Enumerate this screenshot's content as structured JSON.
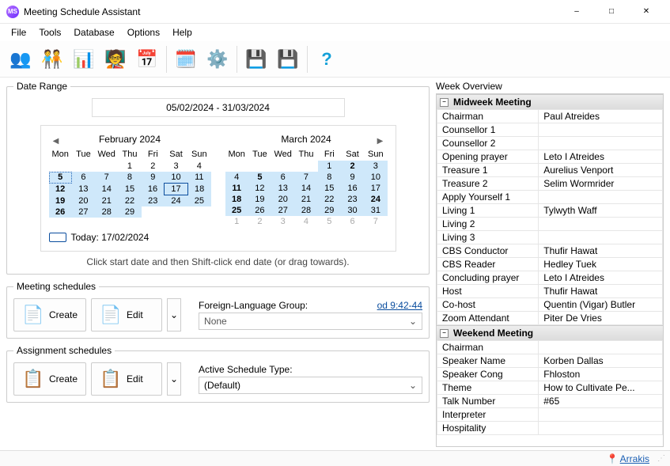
{
  "window": {
    "title": "Meeting Schedule Assistant",
    "app_icon_text": "MS"
  },
  "menu": {
    "items": [
      "File",
      "Tools",
      "Database",
      "Options",
      "Help"
    ]
  },
  "toolbar": {
    "buttons": [
      {
        "name": "congregation-icon"
      },
      {
        "name": "students-icon"
      },
      {
        "name": "report-icon"
      },
      {
        "name": "podium-icon"
      },
      {
        "name": "schedule-icon"
      }
    ],
    "buttons2": [
      {
        "name": "google-calendar-icon"
      },
      {
        "name": "settings-gear-icon"
      }
    ],
    "buttons3": [
      {
        "name": "save-floppy-down-icon"
      },
      {
        "name": "save-floppy-up-icon"
      }
    ],
    "buttons4": [
      {
        "name": "help-icon"
      }
    ]
  },
  "date_range": {
    "legend": "Date Range",
    "readout": "05/02/2024 - 31/03/2024",
    "hint": "Click start date and then Shift-click end date (or drag towards).",
    "today_label": "Today: 17/02/2024",
    "cal1": {
      "title": "February 2024",
      "dow": [
        "Mon",
        "Tue",
        "Wed",
        "Thu",
        "Fri",
        "Sat",
        "Sun"
      ],
      "rows": [
        [
          "",
          "",
          "",
          "1",
          "2",
          "3",
          "4"
        ],
        [
          "5",
          "6",
          "7",
          "8",
          "9",
          "10",
          "11"
        ],
        [
          "12",
          "13",
          "14",
          "15",
          "16",
          "17",
          "18"
        ],
        [
          "19",
          "20",
          "21",
          "22",
          "23",
          "24",
          "25"
        ],
        [
          "26",
          "27",
          "28",
          "29",
          "",
          "",
          ""
        ]
      ],
      "sel_start_row": 1,
      "sel_start_col": 0,
      "start_cell": [
        1,
        0
      ],
      "today_cell": [
        2,
        5
      ],
      "bold_days": [
        "5",
        "12",
        "19",
        "26"
      ]
    },
    "cal2": {
      "title": "March 2024",
      "dow": [
        "Mon",
        "Tue",
        "Wed",
        "Thu",
        "Fri",
        "Sat",
        "Sun"
      ],
      "rows": [
        [
          "",
          "",
          "",
          "",
          "1",
          "2",
          "3"
        ],
        [
          "4",
          "5",
          "6",
          "7",
          "8",
          "9",
          "10"
        ],
        [
          "11",
          "12",
          "13",
          "14",
          "15",
          "16",
          "17"
        ],
        [
          "18",
          "19",
          "20",
          "21",
          "22",
          "23",
          "24"
        ],
        [
          "25",
          "26",
          "27",
          "28",
          "29",
          "30",
          "31"
        ],
        [
          "1",
          "2",
          "3",
          "4",
          "5",
          "6",
          "7"
        ]
      ],
      "gray_row": 5,
      "bold_days": [
        "2",
        "5",
        "11",
        "18",
        "24",
        "25"
      ]
    }
  },
  "meeting_schedules": {
    "legend": "Meeting schedules",
    "create": "Create",
    "edit": "Edit",
    "group_label": "Foreign-Language Group:",
    "link": "od 9:42-44",
    "group_value": "None"
  },
  "assignment_schedules": {
    "legend": "Assignment schedules",
    "create": "Create",
    "edit": "Edit",
    "active_label": "Active Schedule Type:",
    "active_value": "(Default)"
  },
  "week_overview": {
    "title": "Week Overview",
    "midweek": {
      "header": "Midweek Meeting",
      "rows": [
        [
          "Chairman",
          "Paul Atreides"
        ],
        [
          "Counsellor 1",
          ""
        ],
        [
          "Counsellor 2",
          ""
        ],
        [
          "Opening prayer",
          "Leto I Atreides"
        ],
        [
          "Treasure 1",
          "Aurelius Venport"
        ],
        [
          "Treasure 2",
          "Selim Wormrider"
        ],
        [
          "Apply Yourself 1",
          ""
        ],
        [
          "Living 1",
          "Tylwyth Waff"
        ],
        [
          "Living 2",
          ""
        ],
        [
          "Living 3",
          ""
        ],
        [
          "CBS Conductor",
          "Thufir Hawat"
        ],
        [
          "CBS Reader",
          "Hedley Tuek"
        ],
        [
          "Concluding prayer",
          "Leto I Atreides"
        ],
        [
          "Host",
          "Thufir Hawat"
        ],
        [
          "Co-host",
          "Quentin (Vigar) Butler"
        ],
        [
          "Zoom Attendant",
          "Piter De Vries"
        ]
      ]
    },
    "weekend": {
      "header": "Weekend Meeting",
      "rows": [
        [
          "Chairman",
          ""
        ],
        [
          "Speaker Name",
          "Korben Dallas"
        ],
        [
          "Speaker Cong",
          "Fhloston"
        ],
        [
          "Theme",
          "How to Cultivate Pe..."
        ],
        [
          "Talk Number",
          "#65"
        ],
        [
          "Interpreter",
          ""
        ],
        [
          "Hospitality",
          ""
        ]
      ]
    }
  },
  "status": {
    "location": "Arrakis"
  }
}
